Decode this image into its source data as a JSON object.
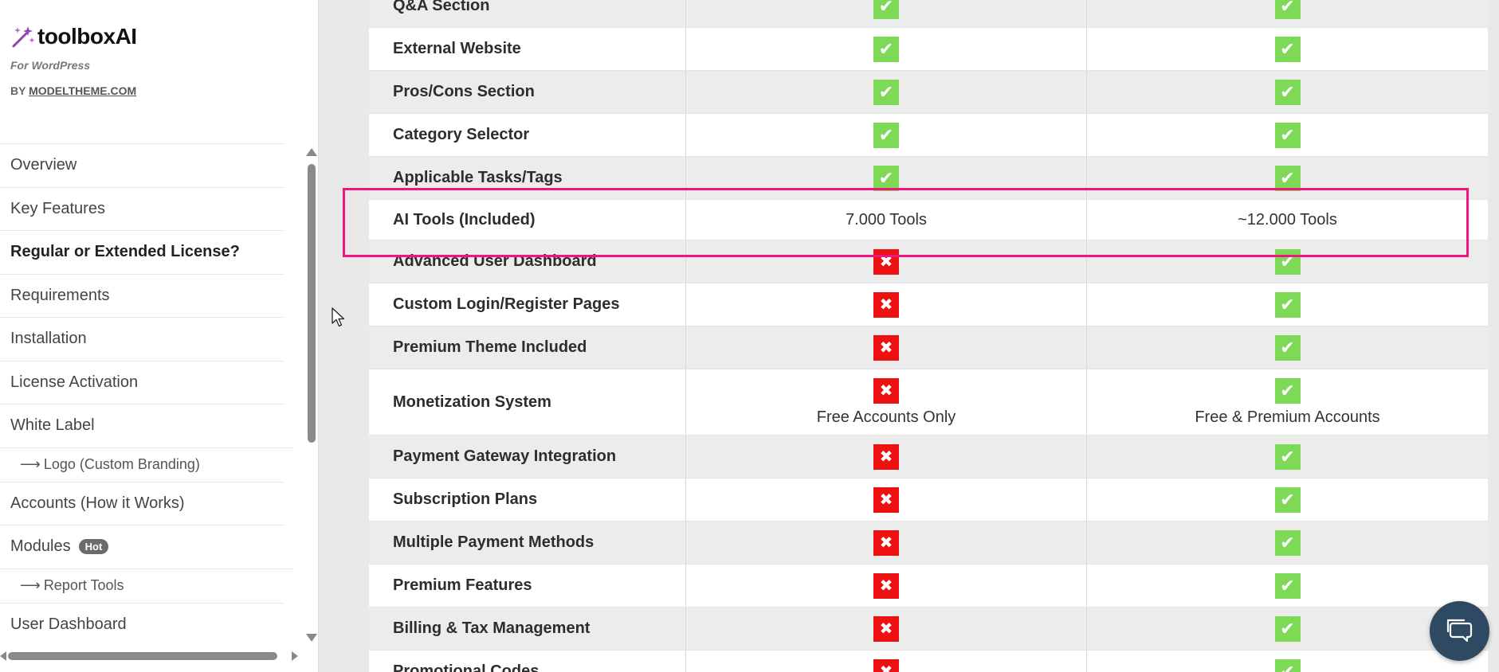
{
  "brand": {
    "name": "toolboxAI",
    "subtitle": "For WordPress",
    "by_prefix": "BY",
    "by_link": "MODELTHEME.COM"
  },
  "sidebar": {
    "items": [
      {
        "label": "Overview"
      },
      {
        "label": "Key Features"
      },
      {
        "label": "Regular or Extended License?",
        "active": true
      },
      {
        "label": "Requirements"
      },
      {
        "label": "Installation"
      },
      {
        "label": "License Activation"
      },
      {
        "label": "White Label"
      },
      {
        "label": "Logo (Custom Branding)",
        "sub": true
      },
      {
        "label": "Accounts (How it Works)"
      },
      {
        "label": "Modules",
        "badge": "Hot"
      },
      {
        "label": "Report Tools",
        "sub": true
      },
      {
        "label": "User Dashboard"
      }
    ],
    "sub_arrow": "⟶"
  },
  "table": {
    "rows": [
      {
        "feature": "Q&A Section",
        "regular": "yes",
        "extended": "yes"
      },
      {
        "feature": "External Website",
        "regular": "yes",
        "extended": "yes"
      },
      {
        "feature": "Pros/Cons Section",
        "regular": "yes",
        "extended": "yes"
      },
      {
        "feature": "Category Selector",
        "regular": "yes",
        "extended": "yes"
      },
      {
        "feature": "Applicable Tasks/Tags",
        "regular": "yes",
        "extended": "yes"
      },
      {
        "feature": "AI Tools (Included)",
        "regular_text": "7.000 Tools",
        "extended_text": "~12.000 Tools"
      },
      {
        "feature": "Advanced User Dashboard",
        "regular": "no",
        "extended": "yes"
      },
      {
        "feature": "Custom Login/Register Pages",
        "regular": "no",
        "extended": "yes"
      },
      {
        "feature": "Premium Theme Included",
        "regular": "no",
        "extended": "yes"
      },
      {
        "feature": "Monetization System",
        "regular": "no",
        "extended": "yes",
        "regular_note": "Free Accounts Only",
        "extended_note": "Free & Premium Accounts"
      },
      {
        "feature": "Payment Gateway Integration",
        "regular": "no",
        "extended": "yes"
      },
      {
        "feature": "Subscription Plans",
        "regular": "no",
        "extended": "yes"
      },
      {
        "feature": "Multiple Payment Methods",
        "regular": "no",
        "extended": "yes"
      },
      {
        "feature": "Premium Features",
        "regular": "no",
        "extended": "yes"
      },
      {
        "feature": "Billing & Tax Management",
        "regular": "no",
        "extended": "yes"
      },
      {
        "feature": "Promotional Codes",
        "regular": "no",
        "extended": "yes"
      }
    ]
  },
  "icons": {
    "yes": "check-icon",
    "no": "x-icon",
    "chat": "chat-icon",
    "logo": "magic-wand-icon"
  },
  "colors": {
    "yes": "#7ed957",
    "no": "#ee1111",
    "highlight": "#f0157f",
    "chat_bg": "#2e4a63",
    "brand_icon": "#8e44ad"
  }
}
